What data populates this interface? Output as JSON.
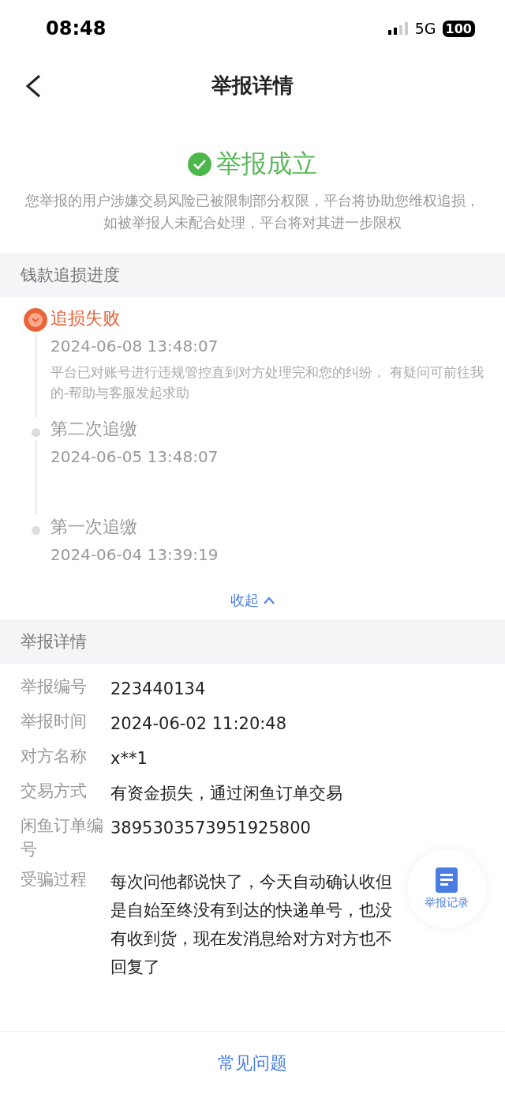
{
  "status_bar": {
    "time": "08:48",
    "network": "5G",
    "battery": "100"
  },
  "nav": {
    "title": "举报详情"
  },
  "result": {
    "title": "举报成立",
    "description": "您举报的用户涉嫌交易风险已被限制部分权限，平台将协助您维权追损，如被举报人未配合处理，平台将对其进一步限权"
  },
  "progress": {
    "heading": "钱款追损进度",
    "items": [
      {
        "kind": "failed",
        "title": "追损失败",
        "time": "2024-06-08 13:48:07",
        "note": "平台已对账号进行违规管控直到对方处理完和您的纠纷， 有疑问可前往我的-帮助与客服发起求助"
      },
      {
        "kind": "step",
        "title": "第二次追缴",
        "time": "2024-06-05 13:48:07"
      },
      {
        "kind": "step",
        "title": "第一次追缴",
        "time": "2024-06-04 13:39:19"
      }
    ],
    "toggle": "收起",
    "expanded": true
  },
  "details": {
    "heading": "举报详情",
    "rows": [
      {
        "label": "举报编号",
        "value": "223440134"
      },
      {
        "label": "举报时间",
        "value": "2024-06-02 11:20:48"
      },
      {
        "label": "对方名称",
        "value": "x**1"
      },
      {
        "label": "交易方式",
        "value": "有资金损失，通过闲鱼订单交易"
      },
      {
        "label": "闲鱼订单编号",
        "value": "3895303573951925800"
      },
      {
        "label": "受骗过程",
        "value": "每次问他都说快了，今天自动确认收但是自始至终没有到达的快递单号，也没有收到货，现在发消息给对方对方也不回复了"
      }
    ]
  },
  "float_button": {
    "label": "举报记录"
  },
  "bottom": {
    "link": "常见问题"
  }
}
